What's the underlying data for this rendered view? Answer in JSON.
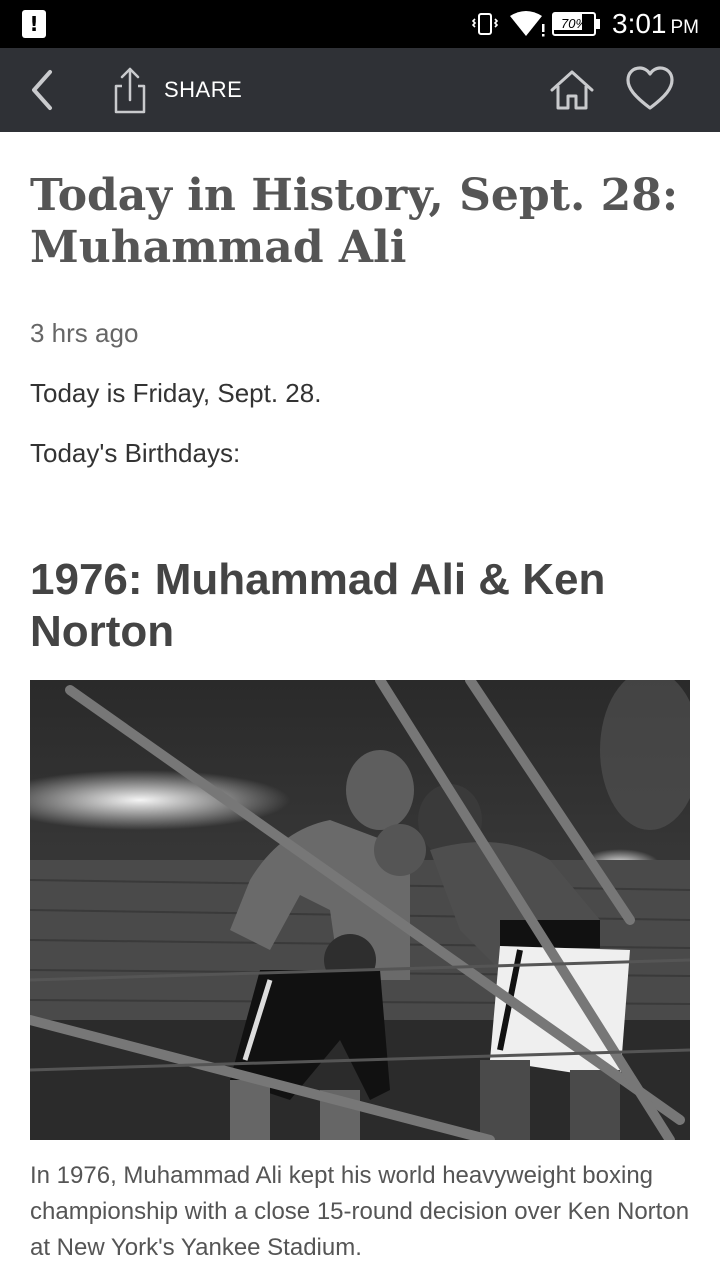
{
  "status_bar": {
    "notification_icon": "alert-icon",
    "battery_level": "70%",
    "battery_fraction": 0.7,
    "time": "3:01",
    "ampm": "PM"
  },
  "app_bar": {
    "share_label": "SHARE",
    "icons": [
      "back-arrow-icon",
      "share-icon",
      "home-icon",
      "heart-icon"
    ],
    "background": "#2f3136"
  },
  "article": {
    "headline": "Today in History, Sept. 28: Muhammad Ali",
    "timestamp": "3 hrs ago",
    "paragraphs": [
      "Today is Friday, Sept. 28.",
      "Today's Birthdays:"
    ],
    "subhead": "1976: Muhammad Ali & Ken Norton",
    "image": {
      "monochrome": true
    },
    "caption": "In 1976, Muhammad Ali kept his world heavyweight boxing championship with a close 15-round decision over Ken Norton at New York's Yankee Stadium."
  }
}
